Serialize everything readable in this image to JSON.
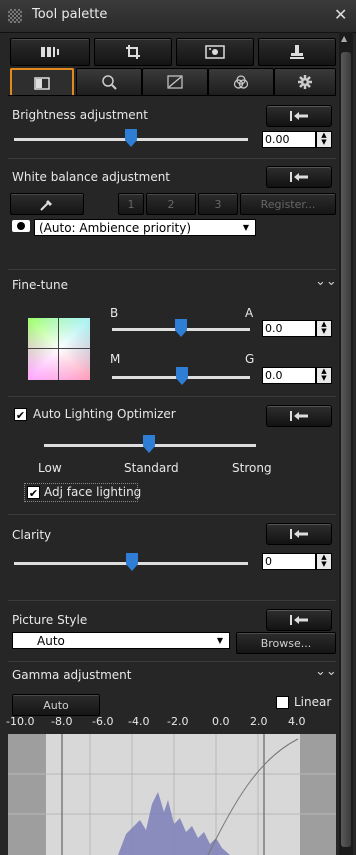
{
  "title": "Tool palette",
  "close_symbol": "✕",
  "brightness": {
    "label": "Brightness adjustment",
    "value": "0.00"
  },
  "white_balance": {
    "label": "White balance adjustment",
    "slot1": "1",
    "slot2": "2",
    "slot3": "3",
    "register": "Register...",
    "mode": "(Auto: Ambience priority)"
  },
  "fine_tune": {
    "label": "Fine-tune",
    "b": "B",
    "a": "A",
    "m": "M",
    "g": "G",
    "ba_value": "0.0",
    "mg_value": "0.0"
  },
  "alo": {
    "label": "Auto Lighting Optimizer",
    "low": "Low",
    "standard": "Standard",
    "strong": "Strong",
    "face": "Adj face lighting",
    "checked": true,
    "face_checked": true
  },
  "clarity": {
    "label": "Clarity",
    "value": "0"
  },
  "picture_style": {
    "label": "Picture Style",
    "value": "Auto",
    "browse": "Browse..."
  },
  "gamma": {
    "label": "Gamma adjustment",
    "auto": "Auto",
    "linear": "Linear",
    "ticks": [
      "-10.0",
      "-8.0",
      "-6.0",
      "-4.0",
      "-2.0",
      "0.0",
      "2.0",
      "4.0"
    ]
  },
  "colors": {
    "accent_tab": "#e08a1e",
    "slider_thumb": "#2e7ed6"
  }
}
